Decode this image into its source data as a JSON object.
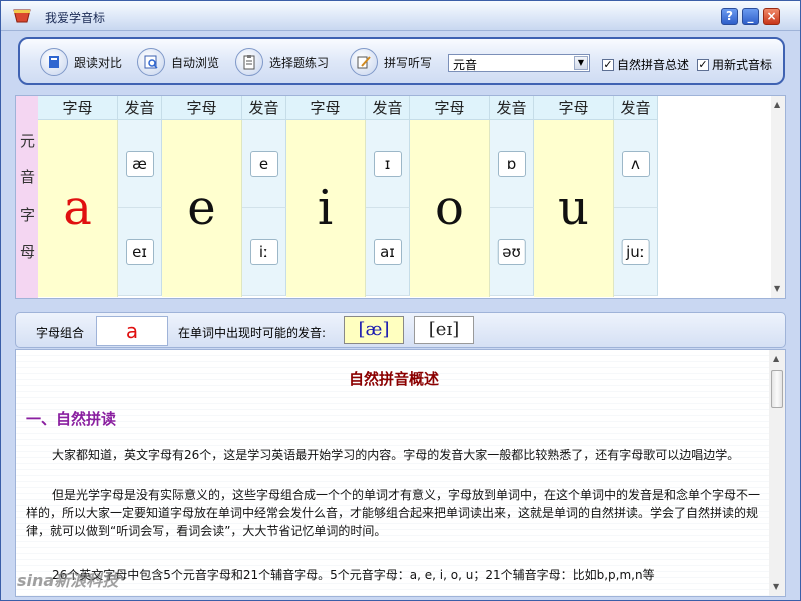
{
  "window": {
    "title": "我爱学音标"
  },
  "toolbar": {
    "buttons": [
      {
        "label": "跟读对比",
        "icon": "book-icon"
      },
      {
        "label": "自动浏览",
        "icon": "browse-icon"
      },
      {
        "label": "选择题练习",
        "icon": "clipboard-icon"
      },
      {
        "label": "拼写听写",
        "icon": "pencil-icon"
      }
    ],
    "select_value": "元音",
    "checks": [
      {
        "label": "自然拼音总述",
        "checked": true
      },
      {
        "label": "用新式音标",
        "checked": true
      }
    ]
  },
  "table": {
    "side_label": [
      "元",
      "音",
      "字",
      "母"
    ],
    "header_letter": "字母",
    "header_sound": "发音",
    "columns": [
      {
        "letter": "a",
        "sounds": [
          "æ",
          "eɪ"
        ]
      },
      {
        "letter": "e",
        "sounds": [
          "e",
          "iː"
        ]
      },
      {
        "letter": "i",
        "sounds": [
          "ɪ",
          "aɪ"
        ]
      },
      {
        "letter": "o",
        "sounds": [
          "ɒ",
          "əʊ"
        ]
      },
      {
        "letter": "u",
        "sounds": [
          "ʌ",
          "juː"
        ]
      }
    ]
  },
  "combo": {
    "label": "字母组合",
    "value": "a",
    "possible_label": "在单词中出现时可能的发音:",
    "pronunciations": [
      "[æ]",
      "[eɪ]"
    ]
  },
  "doc": {
    "title": "自然拼音概述",
    "heading": "一、自然拼读",
    "paragraphs": [
      "大家都知道，英文字母有26个，这是学习英语最开始学习的内容。字母的发音大家一般都比较熟悉了，还有字母歌可以边唱边学。",
      "但是光学字母是没有实际意义的，这些字母组合成一个个的单词才有意义，字母放到单词中，在这个单词中的发音是和念单个字母不一样的，所以大家一定要知道字母放在单词中经常会发什么音，才能够组合起来把单词读出来，这就是单词的自然拼读。学会了自然拼读的规律，就可以做到“听词会写，看词会读”，大大节省记忆单词的时间。",
      "26个英文字母中包含5个元音字母和21个辅音字母。5个元音字母：a, e, i, o, u；21个辅音字母：比如b,p,m,n等"
    ]
  },
  "watermark": "sina新浪科技"
}
